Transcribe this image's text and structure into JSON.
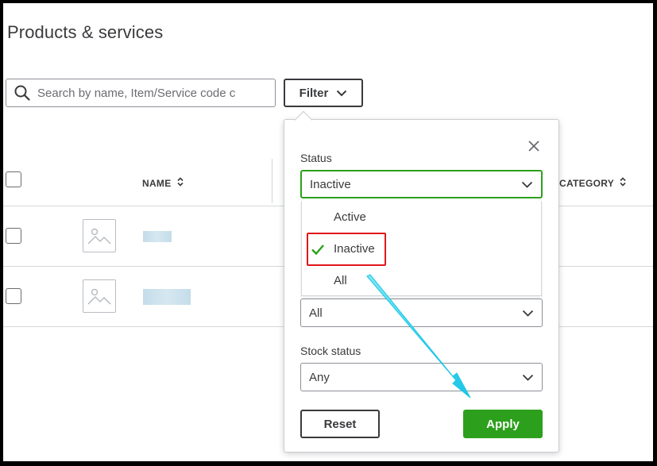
{
  "page": {
    "title": "Products & services"
  },
  "search": {
    "placeholder": "Search by name, Item/Service code c"
  },
  "toolbar": {
    "filter_label": "Filter"
  },
  "table": {
    "columns": {
      "name": "NAME",
      "category": "CATEGORY"
    }
  },
  "filter_panel": {
    "status": {
      "label": "Status",
      "selected": "Inactive",
      "options": [
        "Active",
        "Inactive",
        "All"
      ]
    },
    "type": {
      "selected": "All"
    },
    "stock_status": {
      "label": "Stock status",
      "selected": "Any"
    },
    "reset_label": "Reset",
    "apply_label": "Apply"
  },
  "colors": {
    "accent_green": "#2ca01c",
    "highlight_red": "#e0161b",
    "arrow_cyan": "#19c6e6"
  }
}
